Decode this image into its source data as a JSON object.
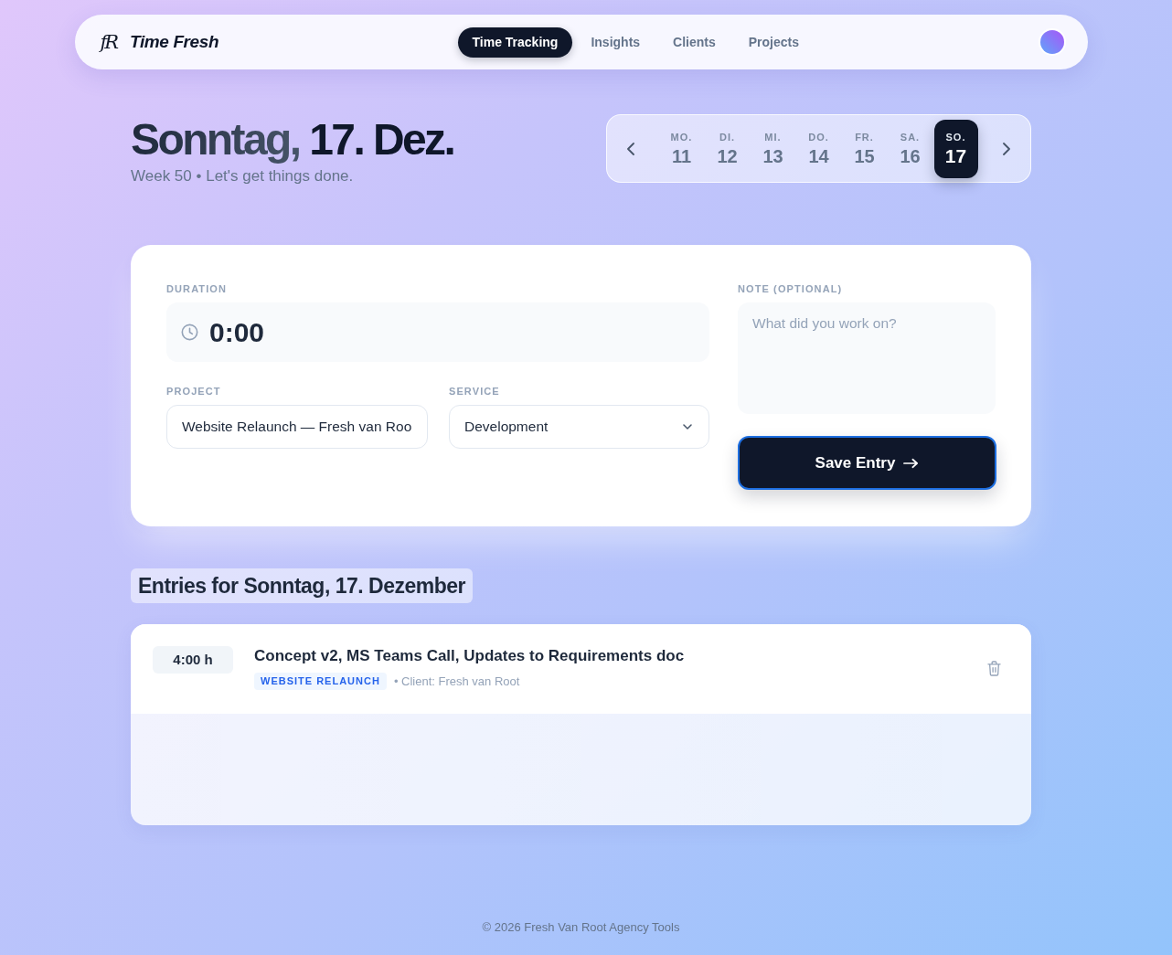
{
  "brand": {
    "monogram": "fR",
    "name": "Time Fresh"
  },
  "nav": {
    "tabs": [
      {
        "label": "Time Tracking",
        "selected": true
      },
      {
        "label": "Insights",
        "selected": false
      },
      {
        "label": "Clients",
        "selected": false
      },
      {
        "label": "Projects",
        "selected": false
      }
    ]
  },
  "header": {
    "title": {
      "weekday": "Sonntag,",
      "date": "17. Dez."
    },
    "subtitle": "Week 50 • Let's get things done."
  },
  "week_strip": {
    "days": [
      {
        "weekday": "MO.",
        "day": "11",
        "selected": false
      },
      {
        "weekday": "DI.",
        "day": "12",
        "selected": false
      },
      {
        "weekday": "MI.",
        "day": "13",
        "selected": false
      },
      {
        "weekday": "DO.",
        "day": "14",
        "selected": false
      },
      {
        "weekday": "FR.",
        "day": "15",
        "selected": false
      },
      {
        "weekday": "SA.",
        "day": "16",
        "selected": false
      },
      {
        "weekday": "SO.",
        "day": "17",
        "selected": true
      }
    ]
  },
  "entry_form": {
    "duration": {
      "label": "DURATION",
      "value": "0:00"
    },
    "project": {
      "label": "PROJECT",
      "value": "Website Relaunch — Fresh van Roo"
    },
    "service": {
      "label": "SERVICE",
      "value": "Development"
    },
    "note": {
      "label": "NOTE (OPTIONAL)",
      "placeholder": "What did you work on?"
    },
    "save_button": "Save Entry"
  },
  "entries": {
    "heading": "Entries for Sonntag, 17. Dezember",
    "items": [
      {
        "duration": "4:00 h",
        "title": "Concept v2, MS Teams Call, Updates to Requirements doc",
        "tag": "WEBSITE RELAUNCH",
        "client": "• Client: Fresh van Root"
      }
    ]
  },
  "footer": "© 2026 Fresh Van Root Agency Tools"
}
